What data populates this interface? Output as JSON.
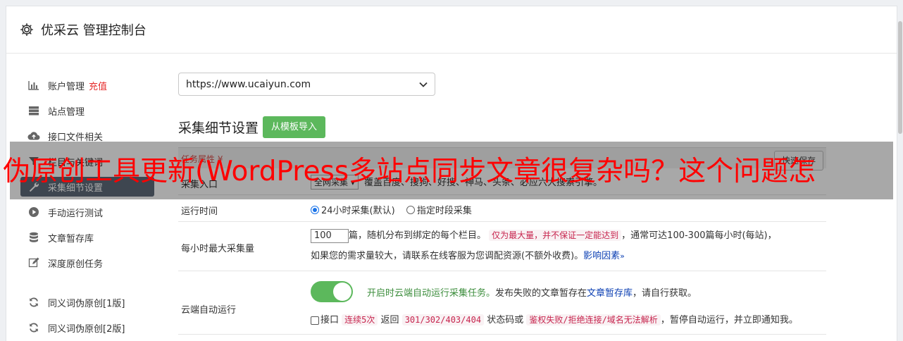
{
  "header": {
    "title": "优采云 管理控制台",
    "icon": "gear-icon"
  },
  "sidebar": {
    "items": [
      {
        "label": "账户管理",
        "badge": "充值",
        "icon": "bar-chart-icon"
      },
      {
        "label": "站点管理",
        "icon": "server-icon"
      },
      {
        "label": "接口文件相关",
        "icon": "cloud-upload-icon"
      },
      {
        "label": "栏目与关键词",
        "icon": "filter-icon"
      },
      {
        "label": "采集细节设置",
        "icon": "wrench-icon",
        "active": true
      },
      {
        "label": "手动运行测试",
        "icon": "play-circle-icon"
      },
      {
        "label": "文章暂存库",
        "icon": "database-icon"
      },
      {
        "label": "深度原创任务",
        "icon": "edit-icon"
      },
      {
        "label": "同义词伪原创[1版]",
        "icon": "refresh-icon"
      },
      {
        "label": "同义词伪原创[2版]",
        "icon": "refresh-icon"
      }
    ]
  },
  "main": {
    "site_select": "https://www.ucaiyun.com",
    "section_title": "采集细节设置",
    "import_button": "从模板导入",
    "tab_label": "任务属性 ¥",
    "quick_save": "快速保存",
    "rows": {
      "entry": {
        "label": "采集入口",
        "select": "全网采集",
        "desc": "覆盖百度、搜狗、好搜、神马、头条、必应六大搜索引擎。"
      },
      "runtime": {
        "label": "运行时间",
        "option1": "24小时采集(默认)",
        "option2": "指定时段采集"
      },
      "max_per_hour": {
        "label": "每小时最大采集量",
        "value": "100",
        "text1": "篇，随机分布到绑定的每个栏目。",
        "highlight": "仅为最大量，并不保证一定能达到",
        "text2": "，通常可达100-300篇每小时(每站)，",
        "text3": "如果您的需求量较大，请联系在线客服为您调配资源(不额外收费)。",
        "link": "影响因素",
        "link_icon": "double-chevron-down-icon"
      },
      "cloud_auto": {
        "label": "云端自动运行",
        "toggle_on": true,
        "green_text": "开启时云端自动运行采集任务。",
        "text1": "发布失败的文章暂存在",
        "link": "文章暂存库",
        "text2": "，请自行获取。",
        "cb_label": "接口",
        "code1": "连续5次",
        "text3": "返回",
        "code2": "301/302/403/404",
        "text4": "状态码或",
        "code3": "鉴权失败/拒绝连接/域名无法解析",
        "text5": "，暂停自动运行，并立即通知我。"
      }
    }
  },
  "overlay": {
    "text": "伪原创工具更新(WordPress多站点同步文章很复杂吗？这个问题怎"
  },
  "colors": {
    "accent_green": "#5cb85c",
    "active_nav": "#5e6b7a",
    "overlay_red": "#ff0000",
    "badge_red": "#e62b2b"
  }
}
